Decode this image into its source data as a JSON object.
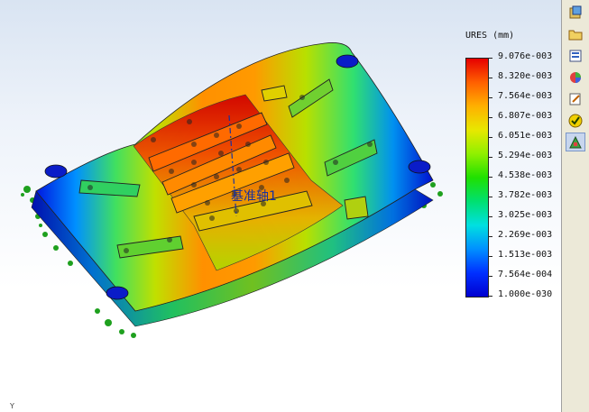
{
  "viewport": {
    "axis_label": "基准轴1",
    "triad_y": "Y"
  },
  "legend": {
    "title": "URES (mm)",
    "labels": [
      "9.076e-003",
      "8.320e-003",
      "7.564e-003",
      "6.807e-003",
      "6.051e-003",
      "5.294e-003",
      "4.538e-003",
      "3.782e-003",
      "3.025e-003",
      "2.269e-003",
      "1.513e-003",
      "7.564e-004",
      "1.000e-030"
    ]
  },
  "toolbar": {
    "items": [
      {
        "name": "part-icon"
      },
      {
        "name": "open-folder-icon"
      },
      {
        "name": "config-manager-icon"
      },
      {
        "name": "appearance-icon"
      },
      {
        "name": "properties-icon"
      },
      {
        "name": "check-icon"
      },
      {
        "name": "simulation-icon"
      }
    ]
  },
  "colors": {
    "max": "#e60000",
    "min": "#0000d0",
    "fixture": "#1ea01e"
  }
}
